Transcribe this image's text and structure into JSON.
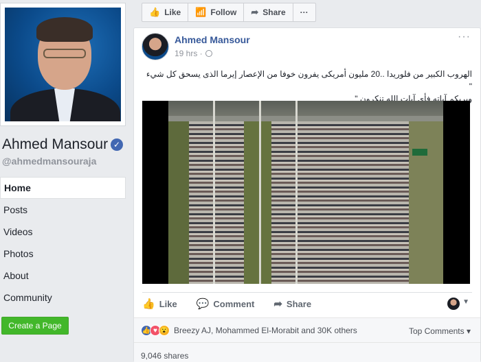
{
  "page": {
    "name": "Ahmed Mansour",
    "handle": "@ahmedmansouraja",
    "verified_icon": "verified-check-icon"
  },
  "nav": {
    "items": [
      {
        "label": "Home",
        "active": true
      },
      {
        "label": "Posts"
      },
      {
        "label": "Videos"
      },
      {
        "label": "Photos"
      },
      {
        "label": "About"
      },
      {
        "label": "Community"
      }
    ]
  },
  "create_page_label": "Create a Page",
  "actionbar": {
    "like": "Like",
    "follow": "Follow",
    "share": "Share",
    "more": "···"
  },
  "post": {
    "author": "Ahmed Mansour",
    "time": "19 hrs · ",
    "menu": "···",
    "text_line1": "الهروب الكبير من فلوريدا ..20 مليون أمريكى يفرون خوفا من الإعصار إيرما الذى يسحق كل شيء \"",
    "text_line2": "ويريكم آياته فأى آيات الله تنكرون \"",
    "actions": {
      "like": "Like",
      "comment": "Comment",
      "share": "Share"
    },
    "reactions_text": "Breezy AJ, Mohammed El-Morabit and 30K others",
    "top_comments": "Top Comments ▾",
    "shares": "9,046 shares"
  },
  "colors": {
    "link_blue": "#365899",
    "brand_blue": "#4267b2",
    "green_button": "#42b72a",
    "bg": "#e9ebee"
  }
}
